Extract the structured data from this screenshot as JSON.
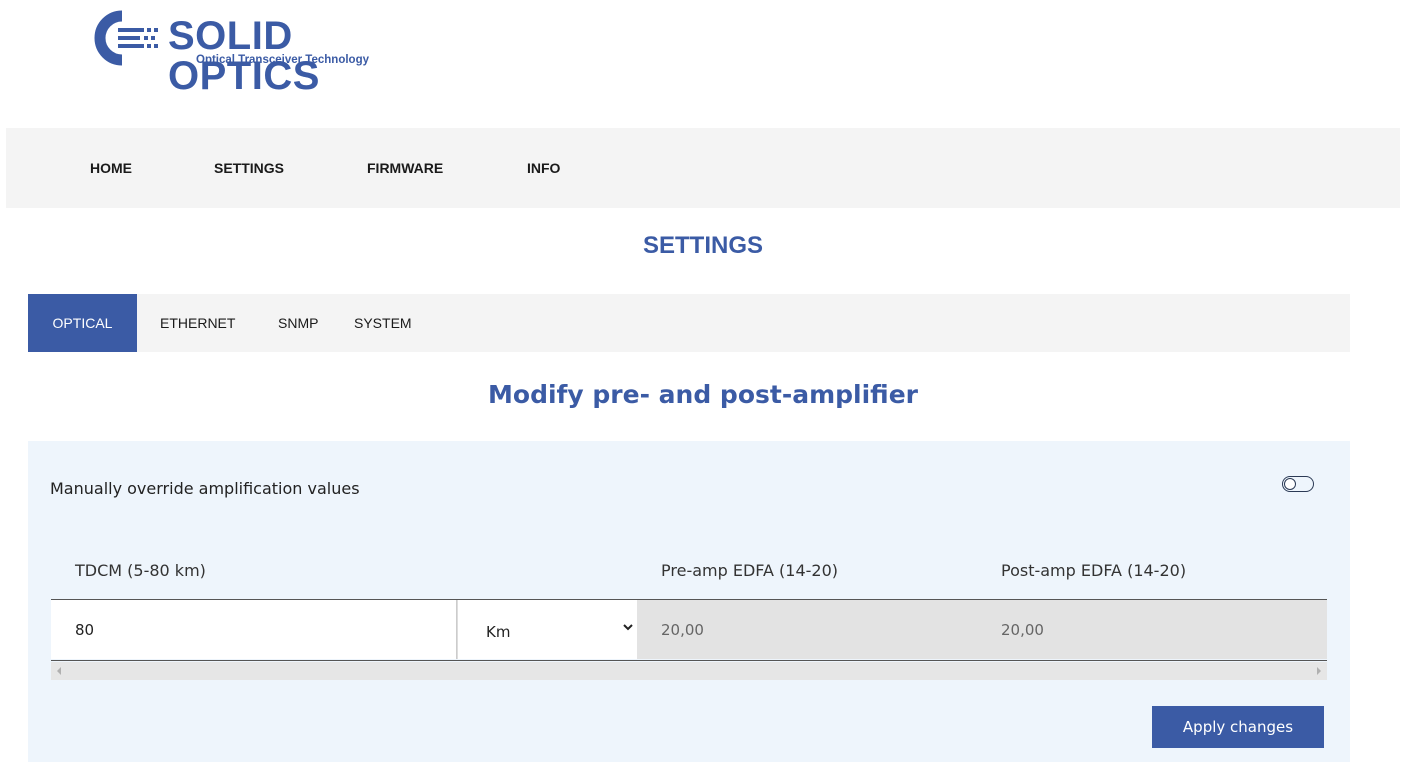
{
  "logo": {
    "brand": "SOLID OPTICS",
    "tagline": "Optical Transceiver Technology",
    "brand_color": "#3b5ba5"
  },
  "nav": {
    "items": [
      {
        "label": "HOME"
      },
      {
        "label": "SETTINGS"
      },
      {
        "label": "FIRMWARE"
      },
      {
        "label": "INFO"
      }
    ]
  },
  "page": {
    "title": "SETTINGS"
  },
  "tabs": [
    {
      "label": "OPTICAL",
      "active": true
    },
    {
      "label": "ETHERNET",
      "active": false
    },
    {
      "label": "SNMP",
      "active": false
    },
    {
      "label": "SYSTEM",
      "active": false
    }
  ],
  "section": {
    "title": "Modify pre- and post-amplifier"
  },
  "panel": {
    "override_label": "Manually override amplification values",
    "override_enabled": false,
    "columns": {
      "tdcm": "TDCM (5-80 km)",
      "pre_amp": "Pre-amp EDFA (14-20)",
      "post_amp": "Post-amp EDFA (14-20)"
    },
    "values": {
      "tdcm": "80",
      "unit": "Km",
      "pre_amp": "20,00",
      "post_amp": "20,00"
    },
    "apply_label": "Apply changes"
  },
  "colors": {
    "accent": "#3b5ba5",
    "panel_bg": "#eef5fc",
    "nav_bg": "#f4f4f4",
    "disabled_bg": "#e3e3e3"
  },
  "icons": {
    "logo_mark": "solid-optics-c-logo-icon",
    "toggle": "toggle-switch-off",
    "select_arrow": "chevron-down-icon",
    "scroll_left": "scroll-left-arrow-icon",
    "scroll_right": "scroll-right-arrow-icon"
  }
}
